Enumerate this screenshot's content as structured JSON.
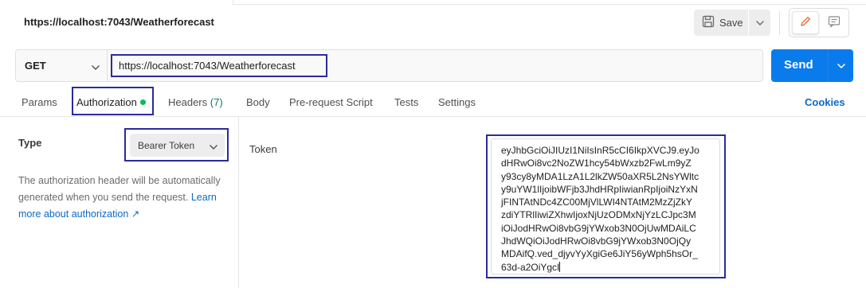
{
  "header": {
    "title": "https://localhost:7043/Weatherforecast",
    "save_label": "Save",
    "save_icon": "save-icon",
    "caret_icon": "chevron-down-icon",
    "edit_icon": "pencil-icon",
    "comment_icon": "comment-icon"
  },
  "request": {
    "method": "GET",
    "url": "https://localhost:7043/Weatherforecast",
    "send_label": "Send"
  },
  "tabs": {
    "params": "Params",
    "authorization": "Authorization",
    "headers": "Headers",
    "headers_count": "(7)",
    "body": "Body",
    "prerequest": "Pre-request Script",
    "tests": "Tests",
    "settings": "Settings",
    "cookies": "Cookies"
  },
  "auth": {
    "type_label": "Type",
    "type_value": "Bearer Token",
    "help_text": "The authorization header will be automatically generated when you send the request.",
    "help_link": "Learn more about authorization ↗",
    "token_label": "Token",
    "token_lines": [
      "eyJhbGciOiJIUzI1NiIsInR5cCI6IkpXVCJ9.eyJo",
      "dHRwOi8vc2NoZW1hcy54bWxzb2FwLm9yZ",
      "y93cy8yMDA1LzA1L2lkZW50aXR5L2NsYWltc",
      "y9uYW1lIjoibWFjb3JhdHRpIiwianRpIjoiNzYxN",
      "jFINTAtNDc4ZC00MjVlLWI4NTAtM2MzZjZkY",
      "zdiYTRlIiwiZXhwIjoxNjUzODMxNjYzLCJpc3M",
      "iOiJodHRwOi8vbG9jYWxob3N0OjUwMDAiLC",
      "JhdWQiOiJodHRwOi8vbG9jYWxob3N0OjQy",
      "MDAifQ.ved_djyvYyXgiGe6JiY56yWph5hsOr_",
      "63d-a2OiYgcI"
    ]
  }
}
